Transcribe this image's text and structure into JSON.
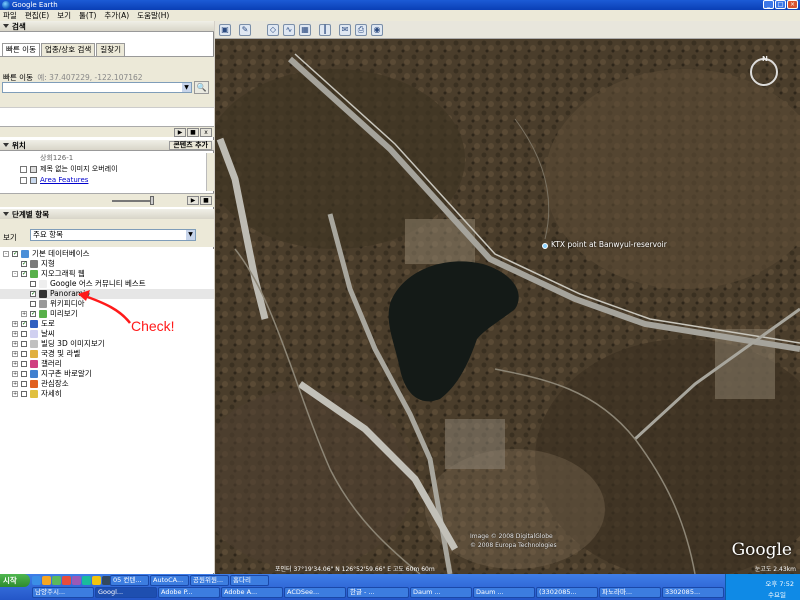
{
  "window": {
    "title": "Google Earth"
  },
  "menu": [
    "파일",
    "편집(E)",
    "보기",
    "툴(T)",
    "추가(A)",
    "도움말(H)"
  ],
  "search_panel": {
    "title": "검색",
    "tabs": [
      "빠른 이동",
      "업종/상호 검색",
      "길찾기"
    ],
    "label": "빠른 이동",
    "hint": "예: 37.407229, -122.107162",
    "input_value": "",
    "go_icon": "search-icon"
  },
  "places_panel": {
    "title": "위치",
    "action": "콘텐츠 추가",
    "items": [
      {
        "label": "상회126-1",
        "is_link": false
      },
      {
        "label": "제목 없는 이미지 오버레이",
        "is_link": false
      },
      {
        "label": "Area Features",
        "is_link": true
      }
    ]
  },
  "layers_panel": {
    "title": "단계별 항목",
    "view_label": "보기",
    "view_value": "주요 항목",
    "tree": [
      {
        "label": "기본 데이터베이스",
        "indent": 0,
        "exp": "−",
        "checked": true,
        "color": "#4b8fd8"
      },
      {
        "label": "지형",
        "indent": 1,
        "exp": "",
        "checked": true,
        "color": "#7a7a7a"
      },
      {
        "label": "지오그래픽 웹",
        "indent": 1,
        "exp": "−",
        "checked": true,
        "color": "#58b04a"
      },
      {
        "label": "Google 어스 커뮤니티 베스트",
        "indent": 2,
        "exp": "",
        "checked": false,
        "color": "#eeeeee"
      },
      {
        "label": "Panoramio",
        "indent": 2,
        "exp": "",
        "checked": true,
        "color": "#333333",
        "highlight": true
      },
      {
        "label": "위키피디아",
        "indent": 2,
        "exp": "",
        "checked": false,
        "color": "#999999"
      },
      {
        "label": "미리보기",
        "indent": 2,
        "exp": "+",
        "checked": true,
        "color": "#58b04a"
      },
      {
        "label": "도로",
        "indent": 1,
        "exp": "+",
        "checked": true,
        "color": "#3060c0"
      },
      {
        "label": "날씨",
        "indent": 1,
        "exp": "+",
        "checked": false,
        "color": "#d0d0f0"
      },
      {
        "label": "빌딩 3D 이미지보기",
        "indent": 1,
        "exp": "+",
        "checked": false,
        "color": "#c0c0c0"
      },
      {
        "label": "국경 및 라벨",
        "indent": 1,
        "exp": "+",
        "checked": false,
        "color": "#e0b040"
      },
      {
        "label": "갤러리",
        "indent": 1,
        "exp": "+",
        "checked": false,
        "color": "#d04080"
      },
      {
        "label": "지구촌 바로알기",
        "indent": 1,
        "exp": "+",
        "checked": false,
        "color": "#4080d0"
      },
      {
        "label": "관심장소",
        "indent": 1,
        "exp": "+",
        "checked": false,
        "color": "#e06020"
      },
      {
        "label": "자세히",
        "indent": 1,
        "exp": "+",
        "checked": false,
        "color": "#e0c040"
      }
    ]
  },
  "annotation": {
    "text": "Check!"
  },
  "map": {
    "placemark_label": "KTX point at Banwyul-reservoir",
    "credit_1": "Image © 2008 DigitalGlobe",
    "credit_2": "© 2008 Europa Technologies",
    "logo": "Google",
    "status": "포인터 37°19'34.06\" N   126°52'59.66\" E   고도 60m       60m",
    "eye_alt": "눈고도 2.43km"
  },
  "taskbar": {
    "start": "시작",
    "tasks": [
      "05 컨텐...",
      "AutoCA...",
      "공원위원...",
      "홈다리",
      "남양주시...",
      "Googl...",
      "Adobe P...",
      "Adobe A...",
      "ACDSee...",
      "한글 - ...",
      "Daum ...",
      "Daum ...",
      "(3302085...",
      "파노라마...",
      "3302085..."
    ],
    "clock": "오후 7:52",
    "date": "수요일"
  }
}
